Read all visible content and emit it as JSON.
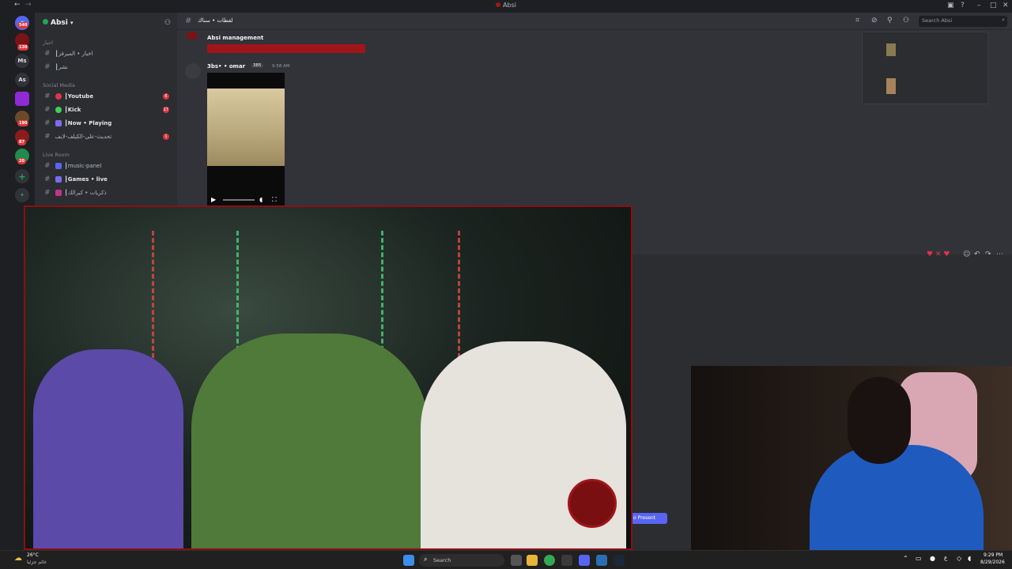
{
  "window": {
    "title": "Absi"
  },
  "rail": {
    "badges": [
      "540",
      "130",
      "190",
      "87",
      "20"
    ],
    "server_labels": [
      "Ms",
      "As"
    ]
  },
  "sidebar": {
    "guild_name": "Absi",
    "cat_ar": "اخبار",
    "cat_social": "Social Media",
    "cat_live": "Live Room",
    "channels": [
      {
        "label": "┃اخبار • الميرفز"
      },
      {
        "label": "┃نشر"
      },
      {
        "label": "┃Youtube",
        "count": "6"
      },
      {
        "label": "┃Kick",
        "count": "17"
      },
      {
        "label": "┃Now • Playing"
      },
      {
        "label": "تحديث-على-الكيلف-لايف",
        "count": "1"
      },
      {
        "label": "┃music-panel"
      },
      {
        "label": "┃Games • live"
      },
      {
        "label": "┃ذكريات • كيرالك"
      }
    ]
  },
  "chat": {
    "header_channel": "لقطات • سناك",
    "search_placeholder": "Search Absi",
    "msg1_author": "Absi management",
    "msg2_author": "3bs• • omar",
    "msg2_tag": "385",
    "msg2_time": "9:58 AM",
    "present_button": "o Present"
  },
  "taskbar": {
    "weather_temp": "26°C",
    "weather_desc": "غائم جزئيا",
    "search_label": "Search",
    "time": "9:29 PM",
    "date": "8/29/2026"
  }
}
